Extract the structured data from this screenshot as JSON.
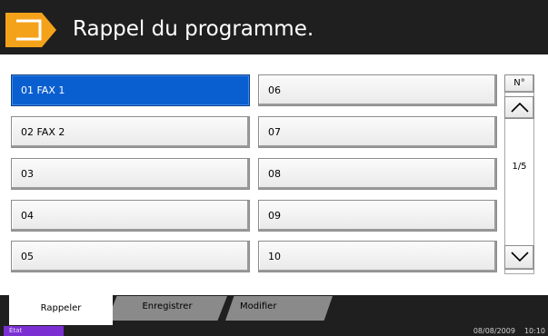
{
  "header": {
    "title": "Rappel du programme.",
    "icon": "program-arrow-icon"
  },
  "slots": [
    {
      "label": "01  FAX 1",
      "selected": true
    },
    {
      "label": "02  FAX 2"
    },
    {
      "label": "03"
    },
    {
      "label": "04"
    },
    {
      "label": "05"
    },
    {
      "label": "06"
    },
    {
      "label": "07"
    },
    {
      "label": "08"
    },
    {
      "label": "09"
    },
    {
      "label": "10"
    }
  ],
  "scroll": {
    "no_label": "N°",
    "page": "1/5",
    "up_icon": "chevron-up-icon",
    "down_icon": "chevron-down-icon"
  },
  "tabs": {
    "recall": "Rappeler",
    "register": "Enregistrer",
    "modify": "Modifier"
  },
  "status": {
    "button": "État",
    "date": "08/08/2009",
    "time": "10:10"
  },
  "colors": {
    "accent": "#f5a21b",
    "selected": "#0a5fd0",
    "status": "#7b2fd3",
    "bar": "#1f1f1f"
  }
}
